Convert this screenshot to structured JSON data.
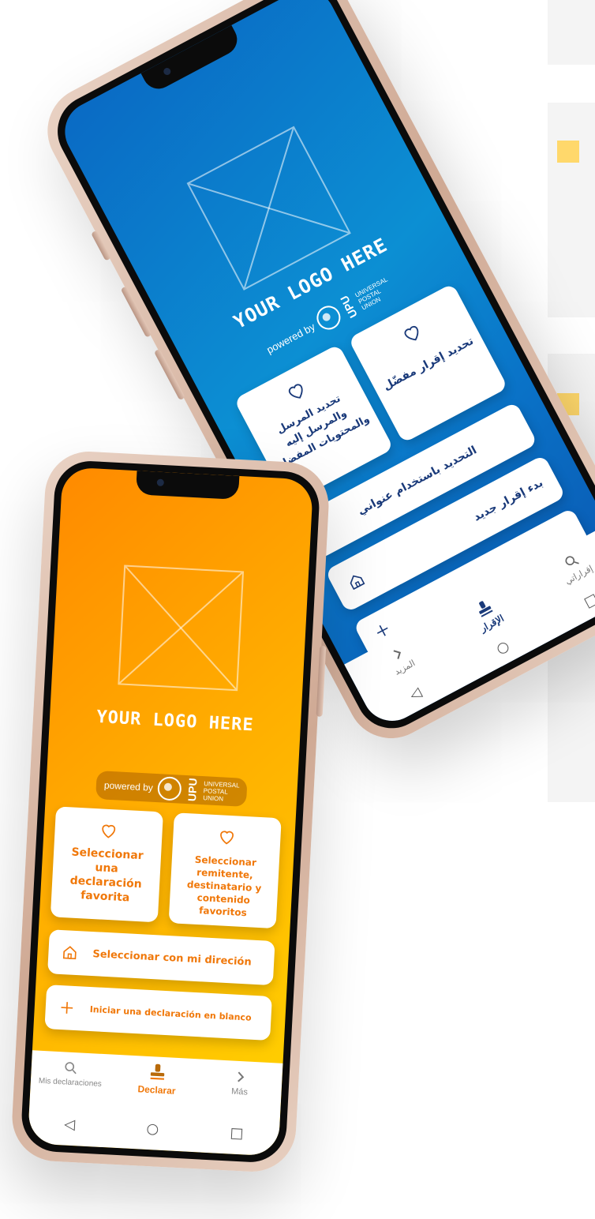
{
  "logo_text": "YOUR LOGO HERE",
  "powered": {
    "label": "powered by",
    "upu_letters": "UPU",
    "upu_name_lines": [
      "UNIVERSAL",
      "POSTAL",
      "UNION"
    ]
  },
  "phone_blue": {
    "cards": [
      {
        "label": "تحديد إقرار مفضّل",
        "icon": "heart-icon"
      },
      {
        "label": "تحديد المرسل والمرسل إليه والمحتويات المفضلة",
        "icon": "heart-icon"
      }
    ],
    "wide_buttons": [
      {
        "label": "التحديد باستخدام عنواني",
        "icon": "home-icon"
      },
      {
        "label": "بدء إقرار جديد",
        "icon": "plus-icon"
      }
    ],
    "nav": [
      {
        "label": "إقراراتي",
        "icon": "search-icon"
      },
      {
        "label": "الإقرار",
        "icon": "stamp-icon"
      },
      {
        "label": "المزيد",
        "icon": "chevron-right-icon"
      }
    ],
    "colors": {
      "accent": "#1a3a7a",
      "bg_top": "#0a6ac4",
      "bg_bottom": "#0a56b0"
    }
  },
  "phone_orange": {
    "cards": [
      {
        "label": "Seleccionar una declaración favorita",
        "icon": "heart-icon"
      },
      {
        "label": "Seleccionar remitente, destinatario y contenido favoritos",
        "icon": "heart-icon"
      }
    ],
    "wide_buttons": [
      {
        "label": "Seleccionar con mi direción",
        "icon": "home-icon"
      },
      {
        "label": "Iniciar una declaración en blanco",
        "icon": "plus-icon"
      }
    ],
    "nav": [
      {
        "label": "Mis declaraciones",
        "icon": "search-icon"
      },
      {
        "label": "Declarar",
        "icon": "stamp-icon"
      },
      {
        "label": "Más",
        "icon": "chevron-right-icon"
      }
    ],
    "colors": {
      "accent": "#f0780a",
      "bg_start": "#ff8a00",
      "bg_end": "#ffd400"
    }
  },
  "system_nav": {
    "back": "◁",
    "home": "○",
    "recents": "□"
  }
}
